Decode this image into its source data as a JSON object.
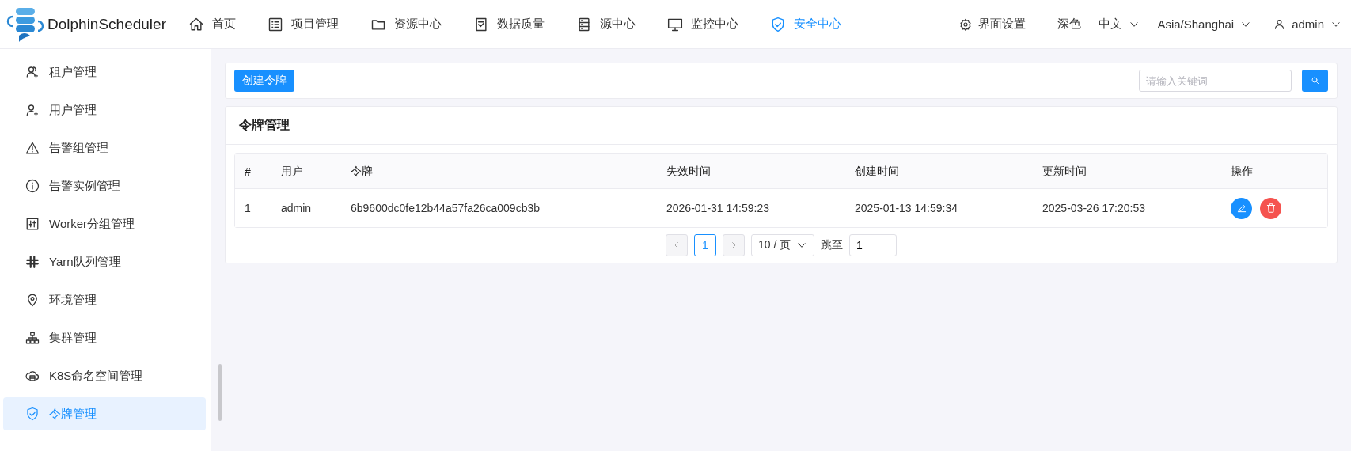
{
  "header": {
    "logo": "DolphinScheduler",
    "nav": [
      {
        "label": "首页",
        "selected": false
      },
      {
        "label": "项目管理",
        "selected": false
      },
      {
        "label": "资源中心",
        "selected": false
      },
      {
        "label": "数据质量",
        "selected": false
      },
      {
        "label": "源中心",
        "selected": false
      },
      {
        "label": "监控中心",
        "selected": false
      },
      {
        "label": "安全中心",
        "selected": true
      }
    ],
    "settings": "界面设置",
    "theme": "深色",
    "language": "中文",
    "timezone": "Asia/Shanghai",
    "user": "admin"
  },
  "sidebar": {
    "items": [
      {
        "label": "租户管理",
        "selected": false
      },
      {
        "label": "用户管理",
        "selected": false
      },
      {
        "label": "告警组管理",
        "selected": false
      },
      {
        "label": "告警实例管理",
        "selected": false
      },
      {
        "label": "Worker分组管理",
        "selected": false
      },
      {
        "label": "Yarn队列管理",
        "selected": false
      },
      {
        "label": "环境管理",
        "selected": false
      },
      {
        "label": "集群管理",
        "selected": false
      },
      {
        "label": "K8S命名空间管理",
        "selected": false
      },
      {
        "label": "令牌管理",
        "selected": true
      }
    ]
  },
  "toolbar": {
    "create_button": "创建令牌",
    "search": {
      "placeholder": "请输入关键词"
    }
  },
  "panel": {
    "title": "令牌管理",
    "table": {
      "columns": [
        "#",
        "用户",
        "令牌",
        "失效时间",
        "创建时间",
        "更新时间",
        "操作"
      ],
      "rows": [
        {
          "cells": [
            "1",
            "admin",
            "6b9600dc0fe12b44a57fa26ca009cb3b",
            "2026-01-31 14:59:23",
            "2025-01-13 14:59:34",
            "2025-03-26 17:20:53"
          ]
        }
      ]
    },
    "pagination": {
      "pages": [
        {
          "label": "1",
          "selected": true
        }
      ],
      "page_size": "10 / 页",
      "jump_label": "跳至",
      "jump_value": "1"
    }
  }
}
